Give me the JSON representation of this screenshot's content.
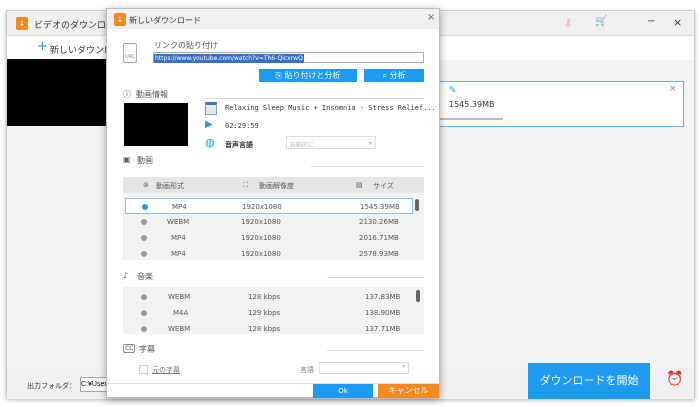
{
  "main_window": {
    "title": "ビデオのダウンロ",
    "new_download": "新しいダウンロ",
    "card_size": "1545.39MB",
    "output_folder_label": "出力フォルダ：",
    "output_folder_value": "C:¥Users",
    "start_download": "ダウンロードを開始",
    "minimize": "−",
    "close": "×"
  },
  "dialog": {
    "title": "新しいダウンロード",
    "close": "×",
    "link_label": "リンクの貼り付け",
    "url": "https://www.youtube.com/watch?v=Th6-QlcxrwQ",
    "paste_analyze": "貼り付けと分析",
    "analyze": "分析",
    "video_info_label": "動画情報",
    "video_title": "Relaxing Sleep Music + Insomnia - Stress Relief...",
    "duration": "02:29:59",
    "audio_lang_label": "音声言語",
    "audio_lang_value": "自動的に",
    "video_section": "動画",
    "col_format": "動画形式",
    "col_resolution": "動画解像度",
    "col_size": "サイズ",
    "video_rows": [
      {
        "format": "MP4",
        "res": "1920x1080",
        "size": "1545.39MB",
        "selected": true
      },
      {
        "format": "WEBM",
        "res": "1920x1080",
        "size": "2130.26MB"
      },
      {
        "format": "MP4",
        "res": "1920x1080",
        "size": "2016.71MB"
      },
      {
        "format": "MP4",
        "res": "1920x1080",
        "size": "2578.93MB"
      }
    ],
    "audio_section": "音楽",
    "audio_rows": [
      {
        "format": "WEBM",
        "rate": "128 kbps",
        "size": "137.83MB"
      },
      {
        "format": "M4A",
        "rate": "129 kbps",
        "size": "138.90MB"
      },
      {
        "format": "WEBM",
        "rate": "128 kbps",
        "size": "137.71MB"
      }
    ],
    "subtitle_section": "字幕",
    "original_subtitle": "元の字幕",
    "language_label": "言語",
    "ok": "Ok",
    "cancel": "キャンセル"
  },
  "colors": {
    "accent": "#1e9bf0",
    "cancel": "#f08a24"
  }
}
